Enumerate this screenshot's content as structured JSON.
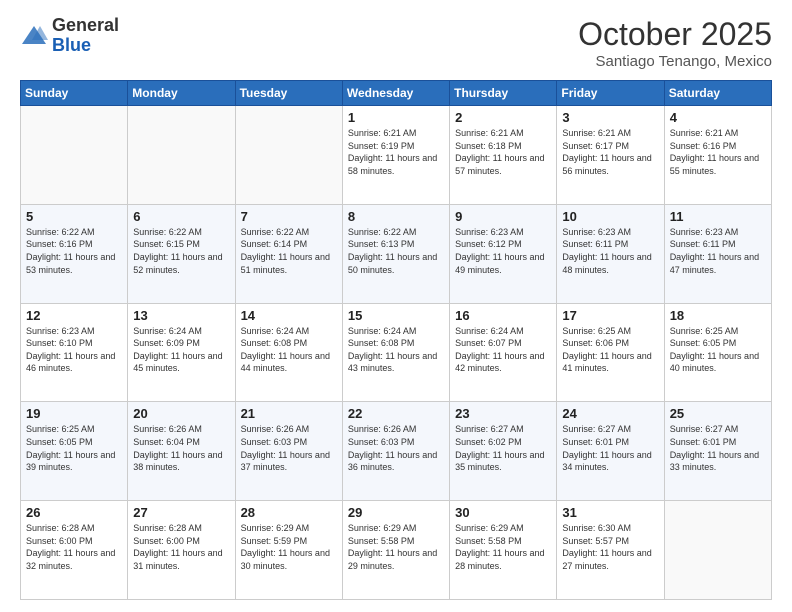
{
  "header": {
    "logo_general": "General",
    "logo_blue": "Blue",
    "month_title": "October 2025",
    "location": "Santiago Tenango, Mexico"
  },
  "weekdays": [
    "Sunday",
    "Monday",
    "Tuesday",
    "Wednesday",
    "Thursday",
    "Friday",
    "Saturday"
  ],
  "weeks": [
    [
      {
        "day": "",
        "info": ""
      },
      {
        "day": "",
        "info": ""
      },
      {
        "day": "",
        "info": ""
      },
      {
        "day": "1",
        "info": "Sunrise: 6:21 AM\nSunset: 6:19 PM\nDaylight: 11 hours and 58 minutes."
      },
      {
        "day": "2",
        "info": "Sunrise: 6:21 AM\nSunset: 6:18 PM\nDaylight: 11 hours and 57 minutes."
      },
      {
        "day": "3",
        "info": "Sunrise: 6:21 AM\nSunset: 6:17 PM\nDaylight: 11 hours and 56 minutes."
      },
      {
        "day": "4",
        "info": "Sunrise: 6:21 AM\nSunset: 6:16 PM\nDaylight: 11 hours and 55 minutes."
      }
    ],
    [
      {
        "day": "5",
        "info": "Sunrise: 6:22 AM\nSunset: 6:16 PM\nDaylight: 11 hours and 53 minutes."
      },
      {
        "day": "6",
        "info": "Sunrise: 6:22 AM\nSunset: 6:15 PM\nDaylight: 11 hours and 52 minutes."
      },
      {
        "day": "7",
        "info": "Sunrise: 6:22 AM\nSunset: 6:14 PM\nDaylight: 11 hours and 51 minutes."
      },
      {
        "day": "8",
        "info": "Sunrise: 6:22 AM\nSunset: 6:13 PM\nDaylight: 11 hours and 50 minutes."
      },
      {
        "day": "9",
        "info": "Sunrise: 6:23 AM\nSunset: 6:12 PM\nDaylight: 11 hours and 49 minutes."
      },
      {
        "day": "10",
        "info": "Sunrise: 6:23 AM\nSunset: 6:11 PM\nDaylight: 11 hours and 48 minutes."
      },
      {
        "day": "11",
        "info": "Sunrise: 6:23 AM\nSunset: 6:11 PM\nDaylight: 11 hours and 47 minutes."
      }
    ],
    [
      {
        "day": "12",
        "info": "Sunrise: 6:23 AM\nSunset: 6:10 PM\nDaylight: 11 hours and 46 minutes."
      },
      {
        "day": "13",
        "info": "Sunrise: 6:24 AM\nSunset: 6:09 PM\nDaylight: 11 hours and 45 minutes."
      },
      {
        "day": "14",
        "info": "Sunrise: 6:24 AM\nSunset: 6:08 PM\nDaylight: 11 hours and 44 minutes."
      },
      {
        "day": "15",
        "info": "Sunrise: 6:24 AM\nSunset: 6:08 PM\nDaylight: 11 hours and 43 minutes."
      },
      {
        "day": "16",
        "info": "Sunrise: 6:24 AM\nSunset: 6:07 PM\nDaylight: 11 hours and 42 minutes."
      },
      {
        "day": "17",
        "info": "Sunrise: 6:25 AM\nSunset: 6:06 PM\nDaylight: 11 hours and 41 minutes."
      },
      {
        "day": "18",
        "info": "Sunrise: 6:25 AM\nSunset: 6:05 PM\nDaylight: 11 hours and 40 minutes."
      }
    ],
    [
      {
        "day": "19",
        "info": "Sunrise: 6:25 AM\nSunset: 6:05 PM\nDaylight: 11 hours and 39 minutes."
      },
      {
        "day": "20",
        "info": "Sunrise: 6:26 AM\nSunset: 6:04 PM\nDaylight: 11 hours and 38 minutes."
      },
      {
        "day": "21",
        "info": "Sunrise: 6:26 AM\nSunset: 6:03 PM\nDaylight: 11 hours and 37 minutes."
      },
      {
        "day": "22",
        "info": "Sunrise: 6:26 AM\nSunset: 6:03 PM\nDaylight: 11 hours and 36 minutes."
      },
      {
        "day": "23",
        "info": "Sunrise: 6:27 AM\nSunset: 6:02 PM\nDaylight: 11 hours and 35 minutes."
      },
      {
        "day": "24",
        "info": "Sunrise: 6:27 AM\nSunset: 6:01 PM\nDaylight: 11 hours and 34 minutes."
      },
      {
        "day": "25",
        "info": "Sunrise: 6:27 AM\nSunset: 6:01 PM\nDaylight: 11 hours and 33 minutes."
      }
    ],
    [
      {
        "day": "26",
        "info": "Sunrise: 6:28 AM\nSunset: 6:00 PM\nDaylight: 11 hours and 32 minutes."
      },
      {
        "day": "27",
        "info": "Sunrise: 6:28 AM\nSunset: 6:00 PM\nDaylight: 11 hours and 31 minutes."
      },
      {
        "day": "28",
        "info": "Sunrise: 6:29 AM\nSunset: 5:59 PM\nDaylight: 11 hours and 30 minutes."
      },
      {
        "day": "29",
        "info": "Sunrise: 6:29 AM\nSunset: 5:58 PM\nDaylight: 11 hours and 29 minutes."
      },
      {
        "day": "30",
        "info": "Sunrise: 6:29 AM\nSunset: 5:58 PM\nDaylight: 11 hours and 28 minutes."
      },
      {
        "day": "31",
        "info": "Sunrise: 6:30 AM\nSunset: 5:57 PM\nDaylight: 11 hours and 27 minutes."
      },
      {
        "day": "",
        "info": ""
      }
    ]
  ]
}
